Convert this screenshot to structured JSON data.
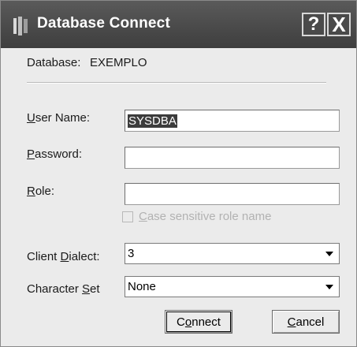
{
  "window": {
    "title": "Database Connect",
    "help_button": "?",
    "close_button": "X"
  },
  "database": {
    "label": "Database:",
    "value": "EXEMPLO"
  },
  "form": {
    "user_name": {
      "label_accel": "U",
      "label_rest": "ser Name:",
      "value": "SYSDBA"
    },
    "password": {
      "label_accel": "P",
      "label_rest": "assword:",
      "value": ""
    },
    "role": {
      "label_accel": "R",
      "label_rest": "ole:",
      "value": ""
    },
    "case_sensitive": {
      "label_accel": "C",
      "label_rest": "ase sensitive role name",
      "checked": false,
      "enabled": false
    },
    "client_dialect": {
      "label_pre": "Client ",
      "label_accel": "D",
      "label_rest": "ialect:",
      "value": "3"
    },
    "character_set": {
      "label_pre": "Character ",
      "label_accel": "S",
      "label_rest": "et",
      "value": "None"
    }
  },
  "buttons": {
    "connect": {
      "pre": "C",
      "accel": "o",
      "rest": "nnect"
    },
    "cancel": {
      "accel": "C",
      "rest": "ancel"
    }
  },
  "icons": {
    "app": "database-icon",
    "combo": "dropdown-arrow-icon"
  }
}
